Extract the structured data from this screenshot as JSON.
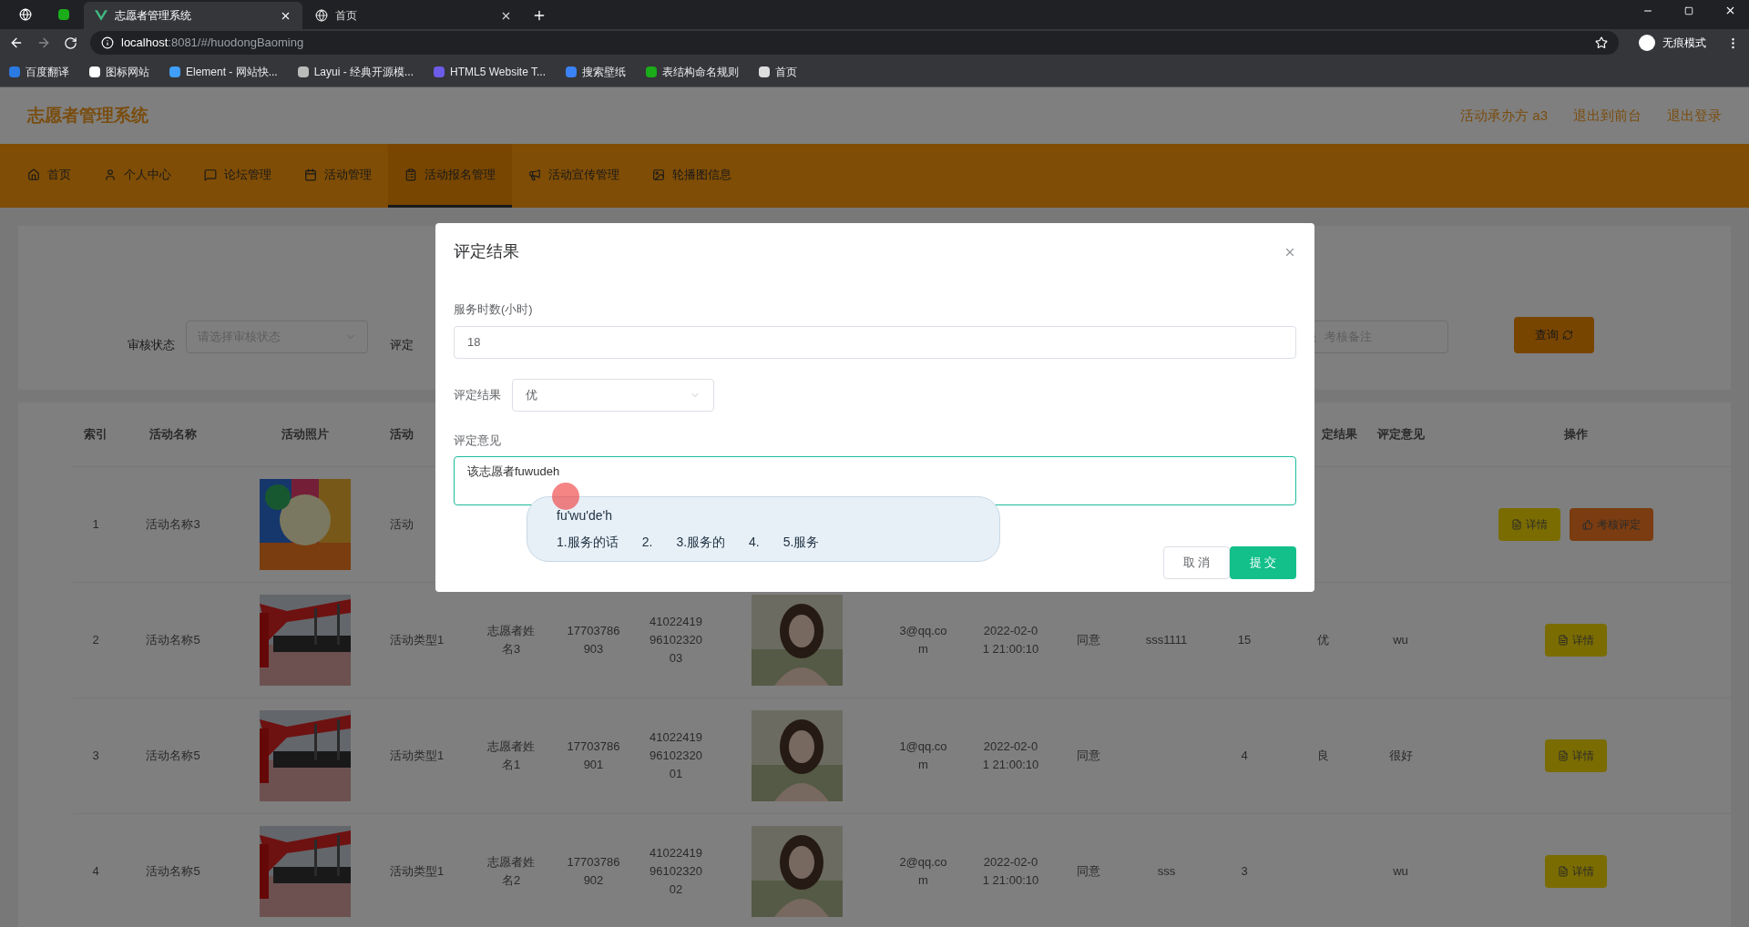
{
  "browser": {
    "tabs": [
      {
        "title": "志愿者管理系统",
        "selected": true
      },
      {
        "title": "首页",
        "selected": false
      }
    ],
    "address": {
      "host": "localhost",
      "path": ":8081/#/huodongBaoming"
    },
    "profile": "无痕模式",
    "bookmarks": [
      "百度翻译",
      "图标网站",
      "Element - 网站快...",
      "Layui - 经典开源模...",
      "HTML5 Website T...",
      "搜索壁纸",
      "表结构命名规则",
      "首页"
    ]
  },
  "app": {
    "title": "志愿者管理系统",
    "user_links": [
      "活动承办方 a3",
      "退出到前台",
      "退出登录"
    ]
  },
  "menu": [
    {
      "label": "首页",
      "selected": false
    },
    {
      "label": "个人中心",
      "selected": false
    },
    {
      "label": "论坛管理",
      "selected": false
    },
    {
      "label": "活动管理",
      "selected": false
    },
    {
      "label": "活动报名管理",
      "selected": true
    },
    {
      "label": "活动宣传管理",
      "selected": false
    },
    {
      "label": "轮播图信息",
      "selected": false
    }
  ],
  "search": {
    "status_label": "审核状态",
    "status_placeholder": "请选择审核状态",
    "result_label": "评定",
    "note_placeholder": "考核备注",
    "button": "查询"
  },
  "table": {
    "columns": [
      "索引",
      "活动名称",
      "活动照片",
      "活动",
      null,
      null,
      null,
      null,
      null,
      null,
      null,
      null,
      null,
      "定结果",
      "评定意见",
      "操作"
    ],
    "rows": [
      {
        "cells": [
          "1",
          "活动名称3",
          {
            "kind": "picture"
          },
          "活动",
          null,
          null,
          null,
          null,
          null,
          null,
          null,
          null,
          null,
          null,
          null
        ],
        "actions": [
          {
            "label": "详情",
            "kind": "detail"
          },
          {
            "label": "考核评定",
            "kind": "evaluate"
          }
        ]
      },
      {
        "cells": [
          "2",
          "活动名称5",
          {
            "kind": "picture"
          },
          "活动类型1",
          "志愿者姓名3",
          "17703786903",
          "410224199610232003",
          {
            "kind": "picture"
          },
          "3@qq.com",
          "2022-02-01 21:00:10",
          "同意",
          "sss1111",
          "15",
          "优",
          "wu"
        ],
        "actions": [
          {
            "label": "详情",
            "kind": "detail"
          }
        ]
      },
      {
        "cells": [
          "3",
          "活动名称5",
          {
            "kind": "picture"
          },
          "活动类型1",
          "志愿者姓名1",
          "17703786901",
          "410224199610232001",
          {
            "kind": "picture"
          },
          "1@qq.com",
          "2022-02-01 21:00:10",
          "同意",
          null,
          "4",
          "良",
          "很好"
        ],
        "actions": [
          {
            "label": "详情",
            "kind": "detail"
          }
        ]
      },
      {
        "cells": [
          "4",
          "活动名称5",
          {
            "kind": "picture"
          },
          "活动类型1",
          "志愿者姓名2",
          "17703786902",
          "410224199610232002",
          {
            "kind": "picture"
          },
          "2@qq.com",
          "2022-02-01 21:00:10",
          "同意",
          "sss",
          "3",
          null,
          "wu"
        ],
        "actions": [
          {
            "label": "详情",
            "kind": "detail"
          }
        ]
      }
    ]
  },
  "dialog": {
    "title": "评定结果",
    "hours_label": "服务时数(小时)",
    "hours_value": "18",
    "result_label": "评定结果",
    "result_value": "优",
    "comment_label": "评定意见",
    "comment_value": "该志愿者fuwudeh",
    "buttons": [
      {
        "label": "取 消",
        "kind": "cancel"
      },
      {
        "label": "提 交",
        "kind": "submit"
      }
    ]
  },
  "ime": {
    "composition": "fu'wu'de'h",
    "candidates": [
      "1.服务的话",
      "2.",
      "3.服务的",
      "4.",
      "5.服务"
    ]
  }
}
